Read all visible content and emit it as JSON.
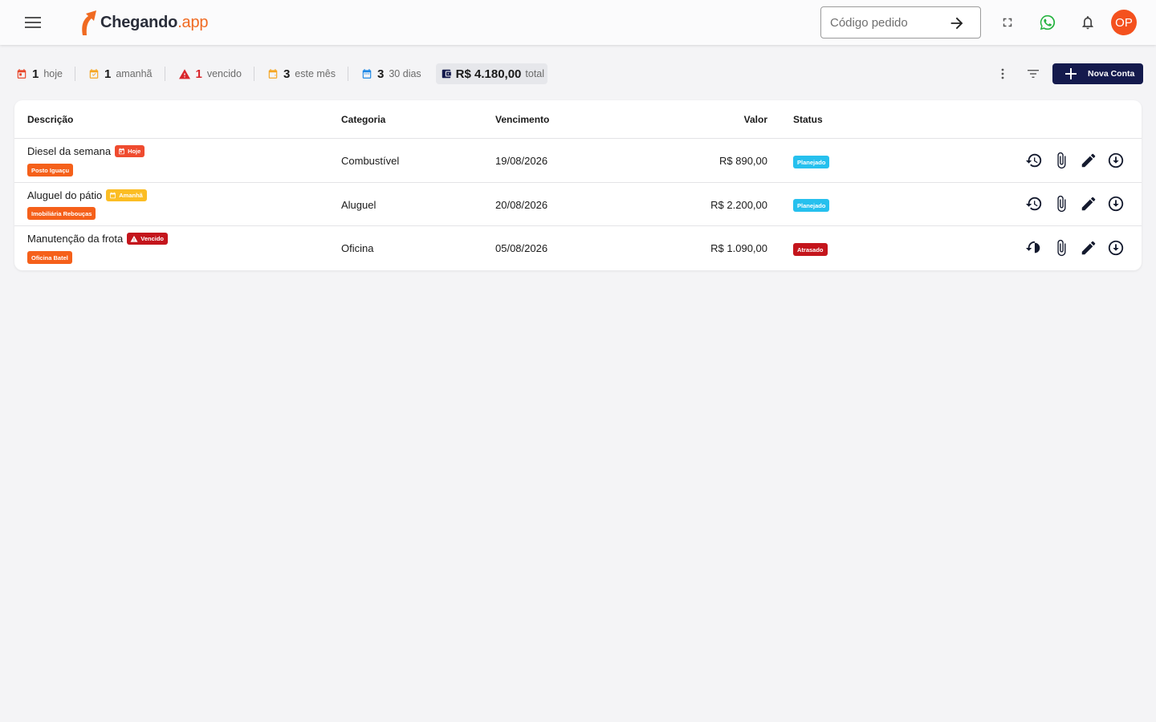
{
  "header": {
    "logo_main": "Chegando",
    "logo_suffix": ".app",
    "code_placeholder": "Código pedido",
    "avatar_initials": "OP"
  },
  "summary": {
    "items": [
      {
        "count": "1",
        "label": "hoje",
        "icon": "calendar-today-icon",
        "color": "#e8472b"
      },
      {
        "count": "1",
        "label": "amanhã",
        "icon": "calendar-check-icon",
        "color": "#f5a623"
      },
      {
        "count": "1",
        "label": "vencido",
        "icon": "warning-icon",
        "color": "#d9262c"
      },
      {
        "count": "3",
        "label": "este mês",
        "icon": "calendar-month-icon",
        "color": "#f5a623"
      },
      {
        "count": "3",
        "label": "30 dias",
        "icon": "calendar-icon",
        "color": "#1e88e5"
      }
    ],
    "total_amount": "R$ 4.180,00",
    "total_label": "total"
  },
  "toolbar": {
    "new_button_label": "Nova Conta"
  },
  "table": {
    "headers": {
      "descricao": "Descrição",
      "categoria": "Categoria",
      "vencimento": "Vencimento",
      "valor": "Valor",
      "status": "Status"
    },
    "rows": [
      {
        "descricao": "Diesel da semana",
        "due_chip": "Hoje",
        "fornecedor": "Posto Iguaçu",
        "categoria": "Combustível",
        "vencimento": "19/08/2026",
        "valor": "R$ 890,00",
        "status": "Planejado"
      },
      {
        "descricao": "Aluguel do pátio",
        "due_chip": "Amanhã",
        "fornecedor": "Imobiliária Rebouças",
        "categoria": "Aluguel",
        "vencimento": "20/08/2026",
        "valor": "R$ 2.200,00",
        "status": "Planejado"
      },
      {
        "descricao": "Manutenção da frota",
        "due_chip": "Vencido",
        "fornecedor": "Oficina Batel",
        "categoria": "Oficina",
        "vencimento": "05/08/2026",
        "valor": "R$ 1.090,00",
        "status": "Atrasado"
      }
    ]
  },
  "colors": {
    "brand_orange": "#f06a21",
    "primary_navy": "#141a4d",
    "status_planned": "#26c0ee",
    "status_late": "#c4151c"
  }
}
